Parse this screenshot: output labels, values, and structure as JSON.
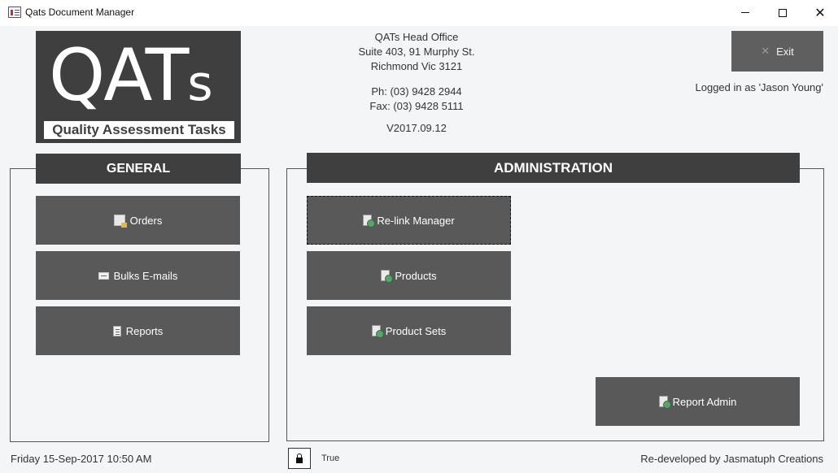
{
  "window": {
    "title": "Qats Document Manager",
    "minimize_symbol": "—",
    "maximize_symbol": "☐",
    "close_symbol": "✕"
  },
  "logo": {
    "letters": "QAT",
    "small_letter": "s",
    "tagline": "Quality Assessment Tasks"
  },
  "office": {
    "name": "QATs Head Office",
    "address1": "Suite 403, 91 Murphy St.",
    "address2": "Richmond Vic 3121",
    "phone": "Ph: (03) 9428 2944",
    "fax": "Fax: (03) 9428 5111",
    "version": "V2017.09.12"
  },
  "exit": {
    "label": "Exit",
    "icon": "x-icon"
  },
  "user": {
    "logged_in": "Logged in as 'Jason Young'"
  },
  "general": {
    "header": "GENERAL",
    "buttons": [
      {
        "label": "Orders",
        "icon": "orders-icon"
      },
      {
        "label": "Bulks E-mails",
        "icon": "email-icon"
      },
      {
        "label": "Reports",
        "icon": "report-icon"
      }
    ]
  },
  "admin": {
    "header": "ADMINISTRATION",
    "buttons": [
      {
        "label": "Re-link Manager",
        "icon": "relink-icon"
      },
      {
        "label": "Products",
        "icon": "relink-icon"
      },
      {
        "label": "Product Sets",
        "icon": "relink-icon"
      },
      {
        "label": "Report Admin",
        "icon": "relink-icon"
      }
    ]
  },
  "footer": {
    "datetime": "Friday 15-Sep-2017 10:50 AM",
    "lock_state": "True",
    "credit": "Re-developed by Jasmatuph Creations"
  },
  "colors": {
    "background": "#f4f5f6",
    "header_dark": "#3f3f3f",
    "button": "#595959",
    "exit_button": "#5f5f5f"
  }
}
